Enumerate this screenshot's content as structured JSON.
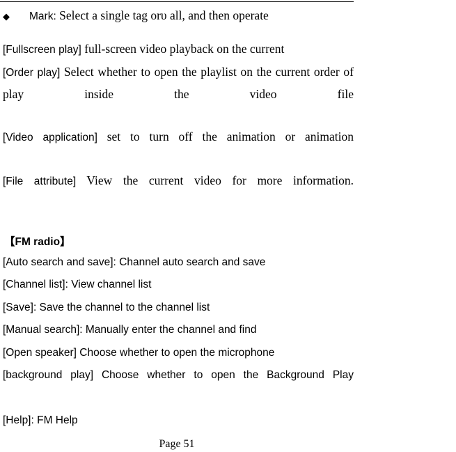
{
  "document": {
    "page_footer": "Page 51",
    "header_rule": true
  },
  "bullet": {
    "marker": "◆",
    "label": "Mark:",
    "text": "Select a single tag orυ all, and then operate"
  },
  "video_settings": {
    "items": [
      {
        "label": "[Fullscreen play]",
        "text": "full-screen video playback on the current",
        "justified": false
      },
      {
        "label": "[Order play]",
        "text": "Select whether to open the playlist on the current order of play inside the video file",
        "justified": true
      },
      {
        "label": "[Video application]",
        "text": "set to turn off the animation or animation",
        "justified": true
      },
      {
        "label": "[File attribute]",
        "text": "View the current video for more information.",
        "justified": true
      }
    ]
  },
  "fm_radio": {
    "heading": "【FM radio】",
    "items": [
      {
        "text": "[Auto search and save]: Channel auto search and save",
        "justified": false
      },
      {
        "text": "[Channel list]: View channel list",
        "justified": false
      },
      {
        "text": "[Save]: Save the channel to the channel list",
        "justified": false
      },
      {
        "text": "[Manual search]: Manually enter the channel and find",
        "justified": false
      },
      {
        "text": "[Open speaker] Choose whether to open the microphone",
        "justified": false
      },
      {
        "text": "[background play] Choose whether to open the Background Play",
        "justified": true
      },
      {
        "text": "[Help]: FM Help",
        "justified": false
      }
    ]
  },
  "colors": {
    "text": "#000000",
    "background": "#ffffff"
  }
}
